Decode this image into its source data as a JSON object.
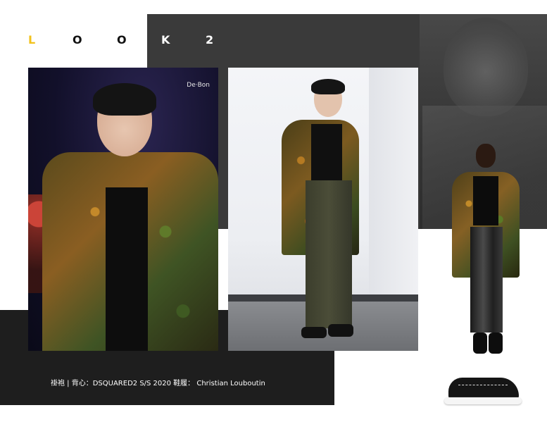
{
  "header": {
    "look_letters": [
      "L",
      "O",
      "O",
      "K",
      "2"
    ]
  },
  "photos": {
    "left_watermark": "De·Bon"
  },
  "caption": {
    "text": "褂袍 | 背心：DSQUARED2 S/S 2020   鞋履： Christian Louboutin"
  },
  "colors": {
    "accent_yellow": "#f2c21b",
    "dark_panel": "#3a3a3a",
    "caption_bar": "#1e1e1e"
  }
}
